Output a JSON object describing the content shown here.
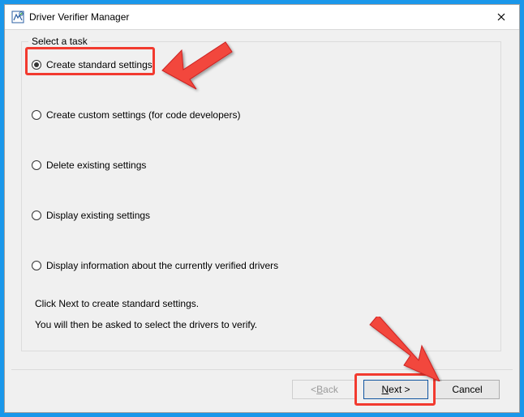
{
  "window": {
    "title": "Driver Verifier Manager"
  },
  "panel_heading": "Select a task",
  "options": [
    {
      "label": "Create standard settings",
      "checked": true
    },
    {
      "label": "Create custom settings (for code developers)",
      "checked": false
    },
    {
      "label": "Delete existing settings",
      "checked": false
    },
    {
      "label": "Display existing settings",
      "checked": false
    },
    {
      "label": "Display information about the currently verified drivers",
      "checked": false
    }
  ],
  "hint_line1": "Click Next to create standard settings.",
  "hint_line2": "You will then be asked to select the drivers to verify.",
  "buttons": {
    "back_prefix": "< ",
    "back_letter": "B",
    "back_rest": "ack",
    "next_letter": "N",
    "next_rest": "ext >",
    "cancel": "Cancel"
  },
  "highlight_color": "#f23a2f"
}
